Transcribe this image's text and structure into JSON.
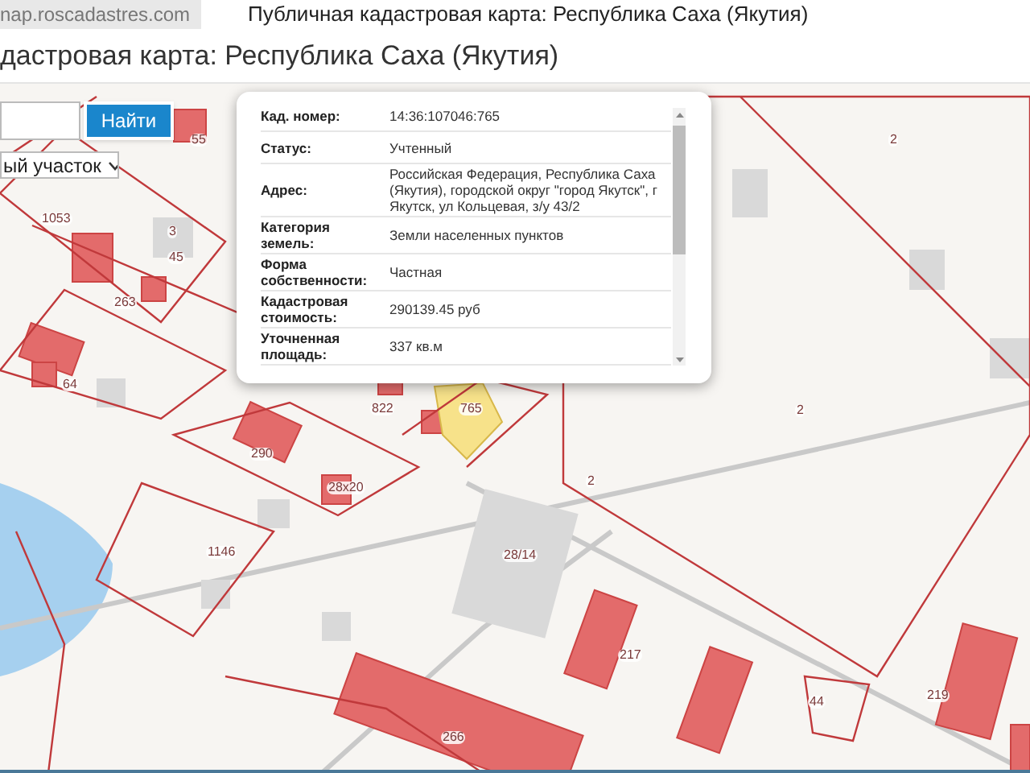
{
  "browser": {
    "address": "nap.roscadastres.com",
    "tab_title": "Публичная кадастровая карта: Республика Саха (Якутия)"
  },
  "page": {
    "heading": "дастровая карта: Республика Саха (Якутия)"
  },
  "search": {
    "button": "Найти",
    "select": "ый участок"
  },
  "popup": {
    "rows": [
      {
        "label": "Кад. номер:",
        "value": "14:36:107046:765"
      },
      {
        "label": "Статус:",
        "value": "Учтенный"
      },
      {
        "label": "Адрес:",
        "value": "Российская Федерация, Республика Саха (Якутия), городской округ \"город Якутск\", г Якутск, ул Кольцевая, з/у 43/2"
      },
      {
        "label": "Категория земель:",
        "value": "Земли населенных пунктов"
      },
      {
        "label": "Форма собственности:",
        "value": "Частная"
      },
      {
        "label": "Кадастровая стоимость:",
        "value": "290139.45 руб"
      },
      {
        "label": "Уточненная площадь:",
        "value": "337 кв.м"
      }
    ]
  },
  "map_labels": [
    "55",
    "1053",
    "3",
    "45",
    "263",
    "64",
    "822",
    "765",
    "290",
    "28x20",
    "1146",
    "28/14",
    "2",
    "2",
    "2",
    "217",
    "219",
    "266",
    "44"
  ]
}
